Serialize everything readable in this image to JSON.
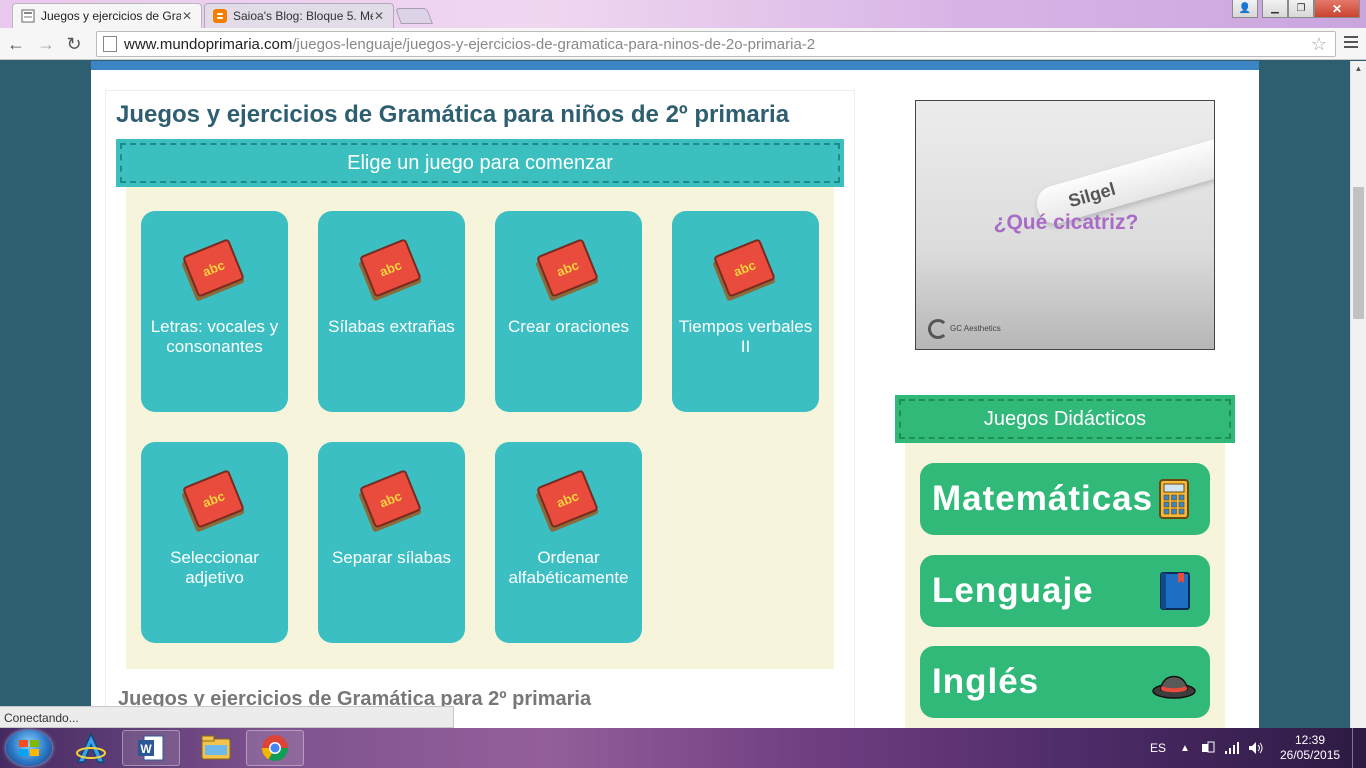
{
  "browser": {
    "tabs": [
      {
        "title": "Juegos y ejercicios de Gra",
        "active": true,
        "icon": "mundoprimaria-favicon"
      },
      {
        "title": "Saioa's Blog: Bloque 5. Mé",
        "active": false,
        "icon": "blogger-favicon"
      }
    ],
    "url_host": "www.mundoprimaria.com",
    "url_path": "/juegos-lenguaje/juegos-y-ejercicios-de-gramatica-para-ninos-de-2o-primaria-2"
  },
  "page": {
    "title": "Juegos y ejercicios de Gramática para niños de 2º primaria",
    "banner": "Elige un juego para comenzar",
    "games": [
      {
        "label": "Letras: vocales y consonantes"
      },
      {
        "label": "Sílabas extrañas"
      },
      {
        "label": "Crear oraciones"
      },
      {
        "label": "Tiempos verbales II"
      },
      {
        "label": "Seleccionar adjetivo"
      },
      {
        "label": "Separar sílabas"
      },
      {
        "label": "Ordenar alfabéticamente"
      }
    ],
    "book_icon_text": "abc",
    "subtitle": "Juegos y ejercicios de Gramática para 2º primaria"
  },
  "ad": {
    "brand": "Silgel",
    "headline": "¿Qué cicatriz?",
    "logo_text": "GC Aesthetics"
  },
  "sidebar": {
    "banner": "Juegos Didácticos",
    "subjects": [
      {
        "label": "Matemáticas",
        "icon": "calculator-icon"
      },
      {
        "label": "Lenguaje",
        "icon": "book-icon"
      },
      {
        "label": "Inglés",
        "icon": "bowler-hat-icon"
      }
    ]
  },
  "status": "Conectando...",
  "taskbar": {
    "language": "ES",
    "time": "12:39",
    "date": "26/05/2015"
  },
  "colors": {
    "teal": "#3bbfc3",
    "green": "#31b97a",
    "cream": "#f6f5db",
    "title": "#2e5f70",
    "topbar_blue": "#3b85c5"
  }
}
